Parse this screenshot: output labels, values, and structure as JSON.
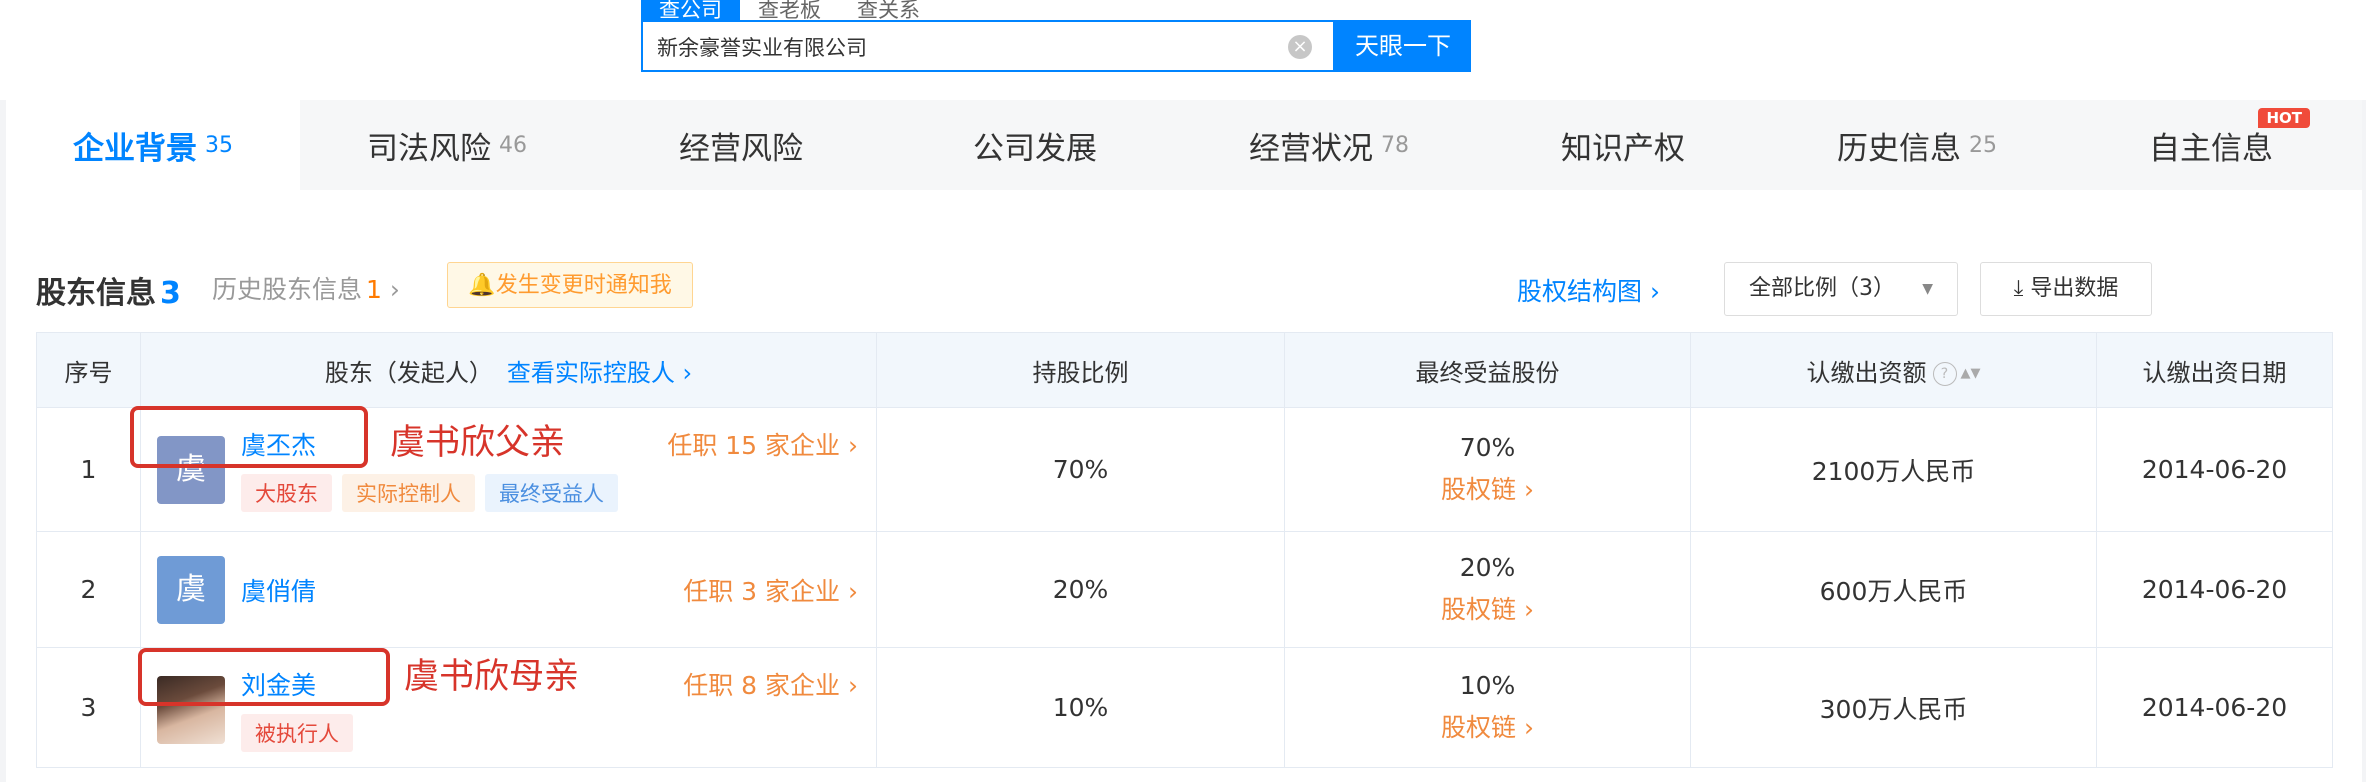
{
  "search": {
    "tabs": [
      "查公司",
      "查老板",
      "查关系"
    ],
    "value": "新余豪誉实业有限公司",
    "button": "天眼一下"
  },
  "nav": [
    {
      "label": "企业背景",
      "count": "35"
    },
    {
      "label": "司法风险",
      "count": "46"
    },
    {
      "label": "经营风险",
      "count": ""
    },
    {
      "label": "公司发展",
      "count": ""
    },
    {
      "label": "经营状况",
      "count": "78"
    },
    {
      "label": "知识产权",
      "count": ""
    },
    {
      "label": "历史信息",
      "count": "25"
    },
    {
      "label": "自主信息",
      "count": "",
      "badge": "HOT"
    }
  ],
  "section": {
    "title": "股东信息",
    "count": "3",
    "history_label": "历史股东信息",
    "history_count": "1",
    "notify": "发生变更时通知我",
    "equity_chart": "股权结构图",
    "ratio_filter": "全部比例（3）",
    "export": "导出数据"
  },
  "table": {
    "headers": {
      "index": "序号",
      "shareholder": "股东（发起人）",
      "actual_controller_link": "查看实际控股人",
      "ratio": "持股比例",
      "benefit": "最终受益股份",
      "capital": "认缴出资额",
      "date": "认缴出资日期"
    },
    "chain_label": "股权链",
    "rows": [
      {
        "index": "1",
        "avatar": "虞",
        "name": "虞丕杰",
        "job": "任职 15 家企业",
        "tags": [
          "大股东",
          "实际控制人",
          "最终受益人"
        ],
        "ratio": "70%",
        "benefit": "70%",
        "capital": "2100万人民币",
        "date": "2014-06-20"
      },
      {
        "index": "2",
        "avatar": "虞",
        "name": "虞俏倩",
        "job": "任职 3 家企业",
        "tags": [],
        "ratio": "20%",
        "benefit": "20%",
        "capital": "600万人民币",
        "date": "2014-06-20"
      },
      {
        "index": "3",
        "avatar": "",
        "name": "刘金美",
        "job": "任职 8 家企业",
        "tags": [
          "被执行人"
        ],
        "ratio": "10%",
        "benefit": "10%",
        "capital": "300万人民币",
        "date": "2014-06-20"
      }
    ]
  },
  "annotations": {
    "father": "虞书欣父亲",
    "mother": "虞书欣母亲"
  },
  "colors": {
    "accent": "#0084ff",
    "annotation_red": "#d7342a",
    "orange": "#f08a3e"
  }
}
